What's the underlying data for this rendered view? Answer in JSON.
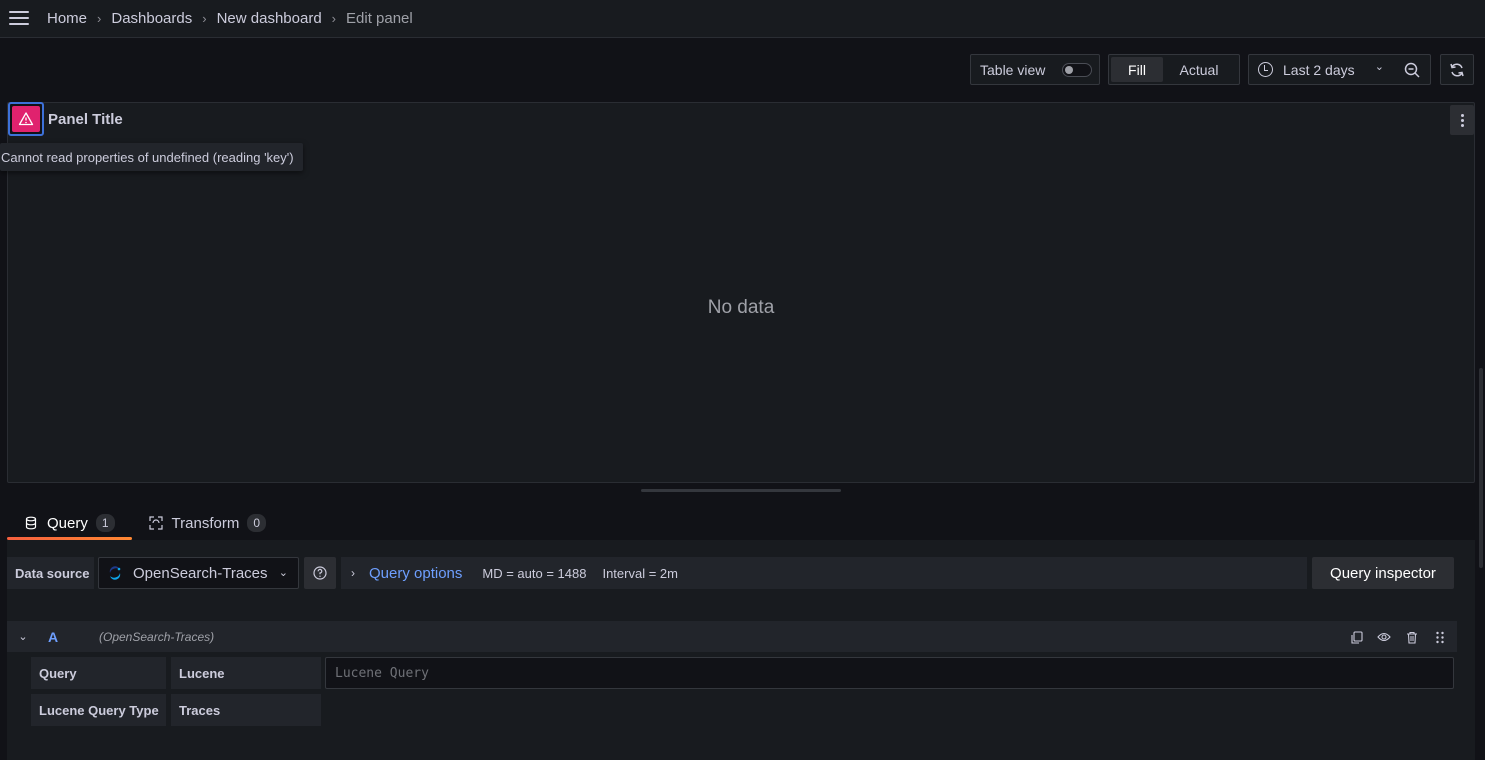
{
  "breadcrumbs": [
    {
      "label": "Home"
    },
    {
      "label": "Dashboards"
    },
    {
      "label": "New dashboard"
    },
    {
      "label": "Edit panel"
    }
  ],
  "toolbar": {
    "table_view_label": "Table view",
    "table_view_on": false,
    "fill_label": "Fill",
    "actual_label": "Actual",
    "time_range": "Last 2 days"
  },
  "panel": {
    "title": "Panel Title",
    "error_message": "Cannot read properties of undefined (reading 'key')",
    "no_data": "No data"
  },
  "tabs": [
    {
      "label": "Query",
      "count": "1",
      "active": true
    },
    {
      "label": "Transform",
      "count": "0",
      "active": false
    }
  ],
  "datasource": {
    "label": "Data source",
    "name": "OpenSearch-Traces"
  },
  "query_options": {
    "title": "Query options",
    "md": "MD = auto = 1488",
    "interval": "Interval = 2m"
  },
  "query_inspector_label": "Query inspector",
  "query_row": {
    "ref_id": "A",
    "datasource": "(OpenSearch-Traces)",
    "query_label": "Query",
    "query_type": "Lucene",
    "lucene_placeholder": "Lucene Query",
    "lucene_value": "",
    "lucene_query_type_label": "Lucene Query Type",
    "lucene_query_type": "Traces"
  },
  "colors": {
    "background": "#111217",
    "panel": "#181b1f",
    "error": "#e0226e",
    "link": "#6e9fff",
    "tab_accent": "#f55f3e"
  }
}
